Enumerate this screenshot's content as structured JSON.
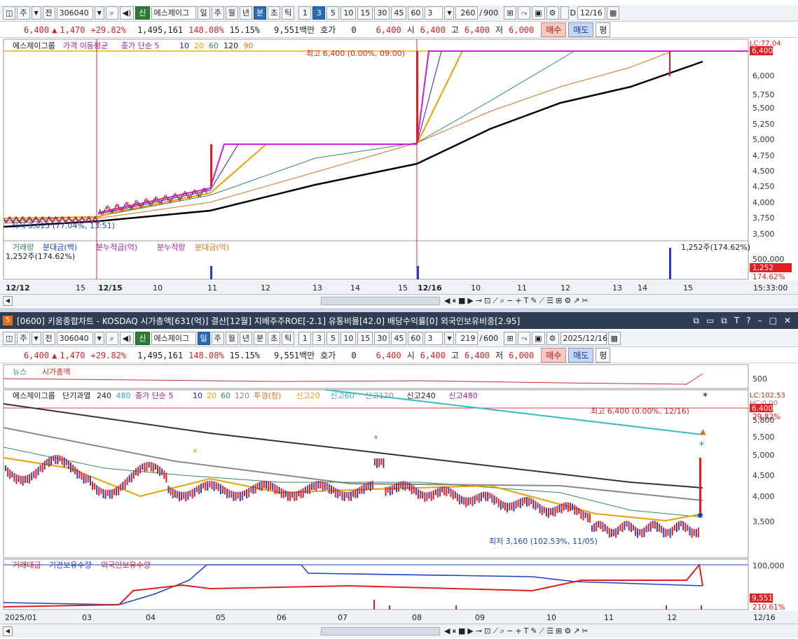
{
  "top": {
    "toolbar": {
      "freq": "주",
      "prev": "전",
      "code": "306040",
      "sin": "신",
      "name": "에스제이그",
      "periods": [
        "일",
        "주",
        "월",
        "년",
        "분",
        "초",
        "틱"
      ],
      "intervals": [
        "1",
        "3",
        "5",
        "10",
        "15",
        "30",
        "45",
        "60"
      ],
      "custom": "3",
      "count": "260",
      "total": "900",
      "date": "12/16",
      "d_label": "D"
    },
    "quote": {
      "price": "6,400",
      "change": "1,470",
      "pct": "+29.82%",
      "volume": "1,495,161",
      "ratio": "148.08%",
      "turnover": "15.15%",
      "amount": "9,551백만",
      "hoga_label": "호가",
      "hoga": "0",
      "ask": "6,400",
      "o_label": "시",
      "o": "6,400",
      "h_label": "고",
      "h": "6,400",
      "l_label": "저",
      "l": "6,000",
      "buy": "매수",
      "sell": "매도",
      "avg": "평"
    },
    "legend": {
      "name": "에스제이그룹",
      "price": "가격 이동평균",
      "ma": "종가 단순 5",
      "p10": "10",
      "p20": "20",
      "p60": "60",
      "p120": "120",
      "p90": "90"
    },
    "yaxis": [
      "6,400",
      "6,000",
      "5,750",
      "5,500",
      "5,250",
      "5,000",
      "4,750",
      "4,500",
      "4,250",
      "4,000",
      "3,750",
      "3,500"
    ],
    "lc": "LC:77.04",
    "hi_note": "최고 6,400 (0.00%, 09:00)",
    "lo_note": "최저 3,615 (77.04%, 13:51)",
    "vol_legend": [
      "거래량",
      "분대금(백)",
      "분누적금(억)",
      "분누적량",
      "분대금(억)"
    ],
    "vol_note": "1,252주(174.62%)",
    "vol_note2": "1,252주(174.62%)",
    "vol_y": "500,000",
    "vol_last": "1,252",
    "vol_pct": "174.62%",
    "xaxis": [
      "12/12",
      "15",
      "12/15",
      "10",
      "11",
      "12",
      "13",
      "14",
      "15",
      "12/16",
      "10",
      "11",
      "12",
      "13",
      "14",
      "15"
    ],
    "time": "15:33:00"
  },
  "title": "[0600] 키움종합차트 - KOSDAQ 시가총액[631(억)] 결산[12월] 지배주주ROE[-2.1] 유통비율[42.0] 배당수익률[0] 외국인보유비중[2.95]",
  "title_num": "5",
  "bottom": {
    "toolbar": {
      "freq": "주",
      "prev": "전",
      "code": "306040",
      "sin": "신",
      "name": "에스제이그",
      "periods": [
        "일",
        "주",
        "월",
        "년",
        "분",
        "초",
        "틱"
      ],
      "intervals": [
        "1",
        "3",
        "5",
        "10",
        "15",
        "30",
        "45",
        "60"
      ],
      "custom": "3",
      "count": "219",
      "total": "600",
      "date": "2025/12/16"
    },
    "quote": {
      "price": "6,400",
      "change": "1,470",
      "pct": "+29.82%",
      "volume": "1,495,161",
      "ratio": "148.08%",
      "turnover": "15.15%",
      "amount": "9,551백만",
      "hoga_label": "호가",
      "hoga": "0",
      "ask": "6,400",
      "o_label": "시",
      "o": "6,400",
      "h_label": "고",
      "h": "6,400",
      "l_label": "저",
      "l": "6,000",
      "buy": "매수",
      "sell": "매도",
      "avg": "평"
    },
    "news": [
      "뉴스",
      "시가총액"
    ],
    "news_y": "500",
    "legend": [
      "에스제이그룹",
      "단기과열",
      "240",
      "480",
      "종가 단순 5",
      "10",
      "20",
      "60",
      "120",
      "투경(청)",
      "신고20",
      "신고60",
      "신고120",
      "신고240",
      "신고480"
    ],
    "lc": "LC:102.53",
    "hc": "HC:0.00",
    "yaxis": [
      "6,400",
      "29.82%",
      "5,800",
      "5,500",
      "5,000",
      "4,500",
      "4,000",
      "3,500"
    ],
    "hi_note": "최고 6,400 (0.00%, 12/16)",
    "lo_note": "최저 3,160 (102.53%, 11/05)",
    "vol_legend": [
      "거래대금",
      "기관보유수량",
      "외국인보유수량"
    ],
    "vol_y": "100,000",
    "vol_last": "9,551",
    "vol_pct": "210.61%",
    "xaxis": [
      "2025/01",
      "03",
      "04",
      "05",
      "06",
      "07",
      "08",
      "09",
      "10",
      "11",
      "12",
      "12/16"
    ]
  },
  "colors": {
    "up": "#e02020",
    "down": "#1e40c8",
    "ma5": "#d01ed0",
    "ma10": "#2020c0",
    "ma20": "#e8a000",
    "ma60": "#2e8b57",
    "ma120": "#e07020",
    "ma_long": "#000000"
  }
}
